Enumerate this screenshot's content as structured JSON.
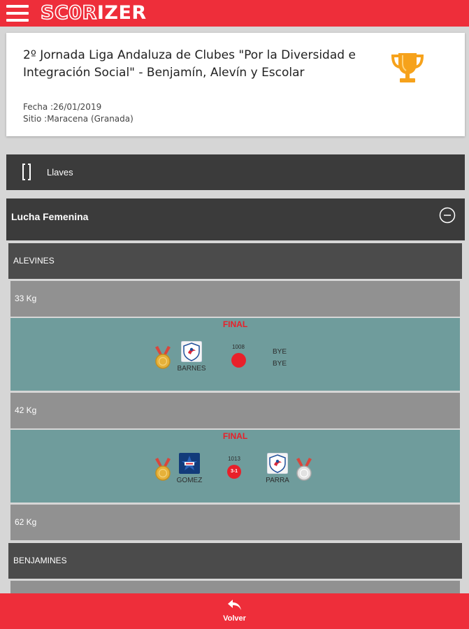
{
  "app": {
    "logo_part1": "SC0R",
    "logo_part2": "IZER"
  },
  "event": {
    "title": "2º Jornada Liga Andaluza de Clubes \"Por la Diversidad e Integración Social\" - Benjamín, Alevín y Escolar",
    "date": "Fecha :26/01/2019",
    "place": "Sitio :Maracena (Granada)"
  },
  "llaves": {
    "label": "Llaves"
  },
  "section": {
    "title": "Lucha Femenina"
  },
  "categories": {
    "alevines": "ALEVINES",
    "benjamines": "BENJAMINES"
  },
  "weights": {
    "w33": "33 Kg",
    "w42": "42 Kg",
    "w62": "62 Kg"
  },
  "matches": [
    {
      "round": "FINAL",
      "bout": "1008",
      "winner": "BARNES",
      "opponent_line1": "BYE",
      "opponent_line2": "BYE"
    },
    {
      "round": "FINAL",
      "bout": "1013",
      "score": "3-1",
      "winner": "GOMEZ",
      "loser": "PARRA"
    }
  ],
  "footer": {
    "back_label": "Volver"
  },
  "colors": {
    "brand": "#ee2e3a",
    "dark_bar": "#3b3b3b",
    "category_bar": "#4b4b4b",
    "weight_bar": "#919191",
    "match_bg": "#6f9c9c",
    "final_text": "#e8202a",
    "gold": "#e6b13a",
    "silver": "#d8d8d8"
  },
  "icons": {
    "menu": "hamburger-menu-icon",
    "trophy": "trophy-icon",
    "bracket": "bracket-icon",
    "collapse": "collapse-circle-icon",
    "back": "back-arrow-icon",
    "gold_medal": "gold-medal-icon",
    "silver_medal": "silver-medal-icon"
  }
}
